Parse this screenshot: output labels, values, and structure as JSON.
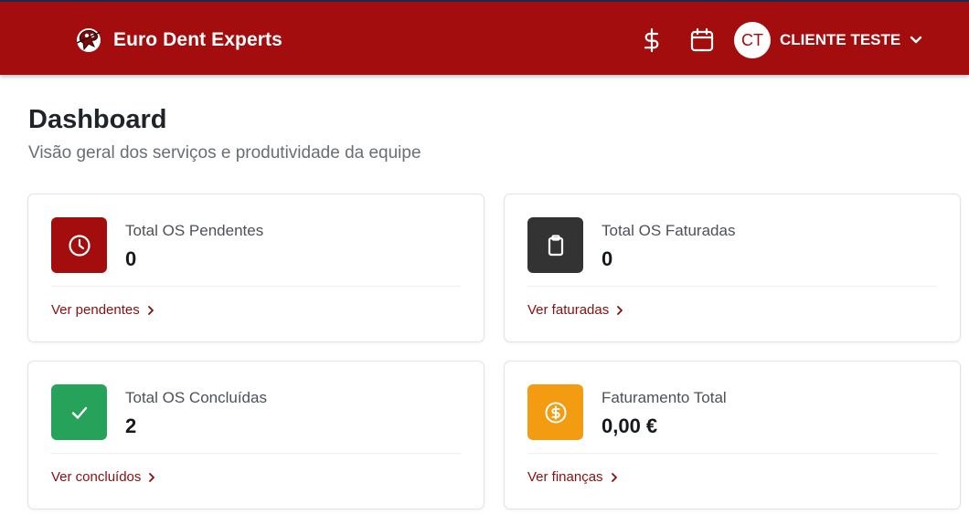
{
  "header": {
    "brand_name": "Euro Dent Experts",
    "icons": [
      "dollar-icon",
      "calendar-icon"
    ],
    "user": {
      "initials": "CT",
      "name": "CLIENTE TESTE"
    }
  },
  "page": {
    "title": "Dashboard",
    "subtitle": "Visão geral dos serviços e produtividade da equipe"
  },
  "cards": [
    {
      "label": "Total OS Pendentes",
      "value": "0",
      "link": "Ver pendentes",
      "icon": "clock-icon",
      "color": "#a30d0d"
    },
    {
      "label": "Total OS Faturadas",
      "value": "0",
      "link": "Ver faturadas",
      "icon": "clipboard-icon",
      "color": "#333333"
    },
    {
      "label": "Total OS Concluídas",
      "value": "2",
      "link": "Ver concluídos",
      "icon": "check-icon",
      "color": "#27a25a"
    },
    {
      "label": "Faturamento Total",
      "value": "0,00 €",
      "link": "Ver finanças",
      "icon": "coin-dollar-icon",
      "color": "#f39c12"
    }
  ],
  "colors": {
    "primary": "#a30d0d",
    "link": "#8d0d0d"
  }
}
